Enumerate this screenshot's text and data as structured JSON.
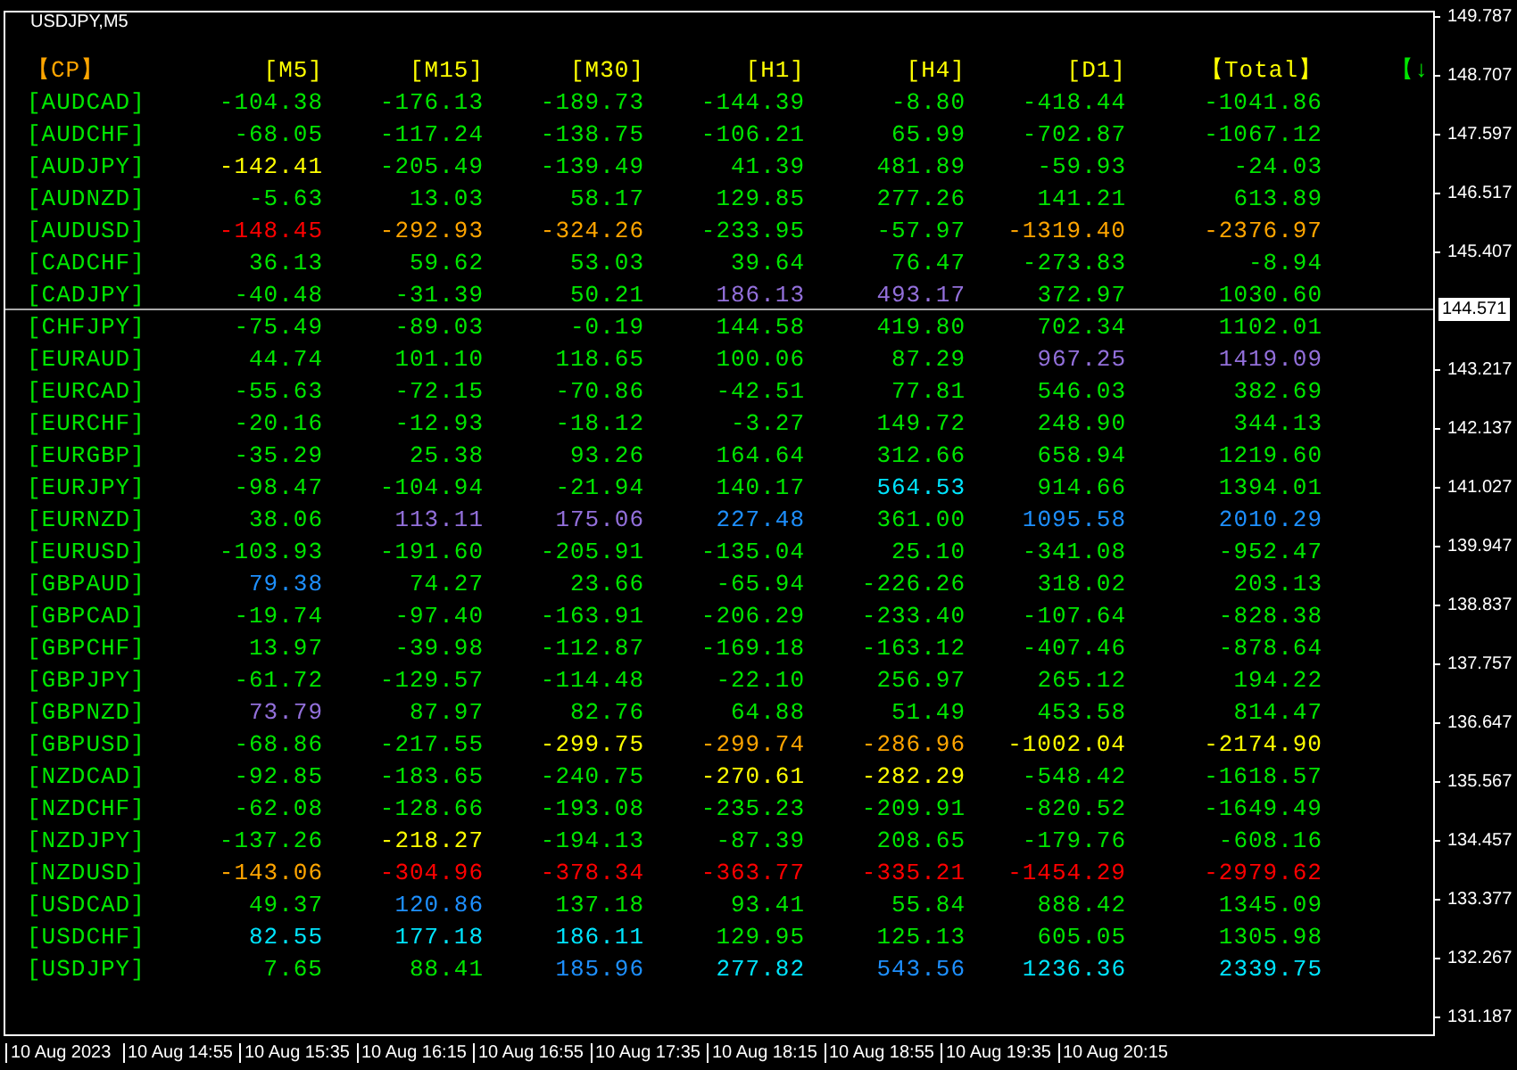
{
  "chart_title": "USDJPY,M5",
  "headers": [
    {
      "text": "【CP】",
      "color": "#ffa500"
    },
    {
      "text": "[M5]",
      "color": "#ffff00"
    },
    {
      "text": "[M15]",
      "color": "#ffff00"
    },
    {
      "text": "[M30]",
      "color": "#ffff00"
    },
    {
      "text": "[H1]",
      "color": "#ffff00"
    },
    {
      "text": "[H4]",
      "color": "#ffff00"
    },
    {
      "text": "[D1]",
      "color": "#ffff00"
    },
    {
      "text": "【Total】",
      "color": "#ffff00"
    },
    {
      "text": "【↓",
      "color": "#00e600"
    }
  ],
  "rows": [
    {
      "pair": "[AUDCAD]",
      "cells": [
        {
          "text": "-104.38",
          "color": "#00e600"
        },
        {
          "text": "-176.13",
          "color": "#00e600"
        },
        {
          "text": "-189.73",
          "color": "#00e600"
        },
        {
          "text": "-144.39",
          "color": "#00e600"
        },
        {
          "text": "-8.80",
          "color": "#00e600"
        },
        {
          "text": "-418.44",
          "color": "#00e600"
        },
        {
          "text": "-1041.86",
          "color": "#00e600"
        }
      ]
    },
    {
      "pair": "[AUDCHF]",
      "cells": [
        {
          "text": "-68.05",
          "color": "#00e600"
        },
        {
          "text": "-117.24",
          "color": "#00e600"
        },
        {
          "text": "-138.75",
          "color": "#00e600"
        },
        {
          "text": "-106.21",
          "color": "#00e600"
        },
        {
          "text": "65.99",
          "color": "#00e600"
        },
        {
          "text": "-702.87",
          "color": "#00e600"
        },
        {
          "text": "-1067.12",
          "color": "#00e600"
        }
      ]
    },
    {
      "pair": "[AUDJPY]",
      "cells": [
        {
          "text": "-142.41",
          "color": "#ffff00"
        },
        {
          "text": "-205.49",
          "color": "#00e600"
        },
        {
          "text": "-139.49",
          "color": "#00e600"
        },
        {
          "text": "41.39",
          "color": "#00e600"
        },
        {
          "text": "481.89",
          "color": "#00e600"
        },
        {
          "text": "-59.93",
          "color": "#00e600"
        },
        {
          "text": "-24.03",
          "color": "#00e600"
        }
      ]
    },
    {
      "pair": "[AUDNZD]",
      "cells": [
        {
          "text": "-5.63",
          "color": "#00e600"
        },
        {
          "text": "13.03",
          "color": "#00e600"
        },
        {
          "text": "58.17",
          "color": "#00e600"
        },
        {
          "text": "129.85",
          "color": "#00e600"
        },
        {
          "text": "277.26",
          "color": "#00e600"
        },
        {
          "text": "141.21",
          "color": "#00e600"
        },
        {
          "text": "613.89",
          "color": "#00e600"
        }
      ]
    },
    {
      "pair": "[AUDUSD]",
      "cells": [
        {
          "text": "-148.45",
          "color": "#ff0000"
        },
        {
          "text": "-292.93",
          "color": "#ffa500"
        },
        {
          "text": "-324.26",
          "color": "#ffa500"
        },
        {
          "text": "-233.95",
          "color": "#00e600"
        },
        {
          "text": "-57.97",
          "color": "#00e600"
        },
        {
          "text": "-1319.40",
          "color": "#ffa500"
        },
        {
          "text": "-2376.97",
          "color": "#ffa500"
        }
      ]
    },
    {
      "pair": "[CADCHF]",
      "cells": [
        {
          "text": "36.13",
          "color": "#00e600"
        },
        {
          "text": "59.62",
          "color": "#00e600"
        },
        {
          "text": "53.03",
          "color": "#00e600"
        },
        {
          "text": "39.64",
          "color": "#00e600"
        },
        {
          "text": "76.47",
          "color": "#00e600"
        },
        {
          "text": "-273.83",
          "color": "#00e600"
        },
        {
          "text": "-8.94",
          "color": "#00e600"
        }
      ]
    },
    {
      "pair": "[CADJPY]",
      "cells": [
        {
          "text": "-40.48",
          "color": "#00e600"
        },
        {
          "text": "-31.39",
          "color": "#00e600"
        },
        {
          "text": "50.21",
          "color": "#00e600"
        },
        {
          "text": "186.13",
          "color": "#9370db"
        },
        {
          "text": "493.17",
          "color": "#9370db"
        },
        {
          "text": "372.97",
          "color": "#00e600"
        },
        {
          "text": "1030.60",
          "color": "#00e600"
        }
      ]
    },
    {
      "pair": "[CHFJPY]",
      "cells": [
        {
          "text": "-75.49",
          "color": "#00e600"
        },
        {
          "text": "-89.03",
          "color": "#00e600"
        },
        {
          "text": "-0.19",
          "color": "#00e600"
        },
        {
          "text": "144.58",
          "color": "#00e600"
        },
        {
          "text": "419.80",
          "color": "#00e600"
        },
        {
          "text": "702.34",
          "color": "#00e600"
        },
        {
          "text": "1102.01",
          "color": "#00e600"
        }
      ]
    },
    {
      "pair": "[EURAUD]",
      "cells": [
        {
          "text": "44.74",
          "color": "#00e600"
        },
        {
          "text": "101.10",
          "color": "#00e600"
        },
        {
          "text": "118.65",
          "color": "#00e600"
        },
        {
          "text": "100.06",
          "color": "#00e600"
        },
        {
          "text": "87.29",
          "color": "#00e600"
        },
        {
          "text": "967.25",
          "color": "#9370db"
        },
        {
          "text": "1419.09",
          "color": "#9370db"
        }
      ]
    },
    {
      "pair": "[EURCAD]",
      "cells": [
        {
          "text": "-55.63",
          "color": "#00e600"
        },
        {
          "text": "-72.15",
          "color": "#00e600"
        },
        {
          "text": "-70.86",
          "color": "#00e600"
        },
        {
          "text": "-42.51",
          "color": "#00e600"
        },
        {
          "text": "77.81",
          "color": "#00e600"
        },
        {
          "text": "546.03",
          "color": "#00e600"
        },
        {
          "text": "382.69",
          "color": "#00e600"
        }
      ]
    },
    {
      "pair": "[EURCHF]",
      "cells": [
        {
          "text": "-20.16",
          "color": "#00e600"
        },
        {
          "text": "-12.93",
          "color": "#00e600"
        },
        {
          "text": "-18.12",
          "color": "#00e600"
        },
        {
          "text": "-3.27",
          "color": "#00e600"
        },
        {
          "text": "149.72",
          "color": "#00e600"
        },
        {
          "text": "248.90",
          "color": "#00e600"
        },
        {
          "text": "344.13",
          "color": "#00e600"
        }
      ]
    },
    {
      "pair": "[EURGBP]",
      "cells": [
        {
          "text": "-35.29",
          "color": "#00e600"
        },
        {
          "text": "25.38",
          "color": "#00e600"
        },
        {
          "text": "93.26",
          "color": "#00e600"
        },
        {
          "text": "164.64",
          "color": "#00e600"
        },
        {
          "text": "312.66",
          "color": "#00e600"
        },
        {
          "text": "658.94",
          "color": "#00e600"
        },
        {
          "text": "1219.60",
          "color": "#00e600"
        }
      ]
    },
    {
      "pair": "[EURJPY]",
      "cells": [
        {
          "text": "-98.47",
          "color": "#00e600"
        },
        {
          "text": "-104.94",
          "color": "#00e600"
        },
        {
          "text": "-21.94",
          "color": "#00e600"
        },
        {
          "text": "140.17",
          "color": "#00e600"
        },
        {
          "text": "564.53",
          "color": "#00e5ff"
        },
        {
          "text": "914.66",
          "color": "#00e600"
        },
        {
          "text": "1394.01",
          "color": "#00e600"
        }
      ]
    },
    {
      "pair": "[EURNZD]",
      "cells": [
        {
          "text": "38.06",
          "color": "#00e600"
        },
        {
          "text": "113.11",
          "color": "#9370db"
        },
        {
          "text": "175.06",
          "color": "#9370db"
        },
        {
          "text": "227.48",
          "color": "#1e90ff"
        },
        {
          "text": "361.00",
          "color": "#00e600"
        },
        {
          "text": "1095.58",
          "color": "#1e90ff"
        },
        {
          "text": "2010.29",
          "color": "#1e90ff"
        }
      ]
    },
    {
      "pair": "[EURUSD]",
      "cells": [
        {
          "text": "-103.93",
          "color": "#00e600"
        },
        {
          "text": "-191.60",
          "color": "#00e600"
        },
        {
          "text": "-205.91",
          "color": "#00e600"
        },
        {
          "text": "-135.04",
          "color": "#00e600"
        },
        {
          "text": "25.10",
          "color": "#00e600"
        },
        {
          "text": "-341.08",
          "color": "#00e600"
        },
        {
          "text": "-952.47",
          "color": "#00e600"
        }
      ]
    },
    {
      "pair": "[GBPAUD]",
      "cells": [
        {
          "text": "79.38",
          "color": "#1e90ff"
        },
        {
          "text": "74.27",
          "color": "#00e600"
        },
        {
          "text": "23.66",
          "color": "#00e600"
        },
        {
          "text": "-65.94",
          "color": "#00e600"
        },
        {
          "text": "-226.26",
          "color": "#00e600"
        },
        {
          "text": "318.02",
          "color": "#00e600"
        },
        {
          "text": "203.13",
          "color": "#00e600"
        }
      ]
    },
    {
      "pair": "[GBPCAD]",
      "cells": [
        {
          "text": "-19.74",
          "color": "#00e600"
        },
        {
          "text": "-97.40",
          "color": "#00e600"
        },
        {
          "text": "-163.91",
          "color": "#00e600"
        },
        {
          "text": "-206.29",
          "color": "#00e600"
        },
        {
          "text": "-233.40",
          "color": "#00e600"
        },
        {
          "text": "-107.64",
          "color": "#00e600"
        },
        {
          "text": "-828.38",
          "color": "#00e600"
        }
      ]
    },
    {
      "pair": "[GBPCHF]",
      "cells": [
        {
          "text": "13.97",
          "color": "#00e600"
        },
        {
          "text": "-39.98",
          "color": "#00e600"
        },
        {
          "text": "-112.87",
          "color": "#00e600"
        },
        {
          "text": "-169.18",
          "color": "#00e600"
        },
        {
          "text": "-163.12",
          "color": "#00e600"
        },
        {
          "text": "-407.46",
          "color": "#00e600"
        },
        {
          "text": "-878.64",
          "color": "#00e600"
        }
      ]
    },
    {
      "pair": "[GBPJPY]",
      "cells": [
        {
          "text": "-61.72",
          "color": "#00e600"
        },
        {
          "text": "-129.57",
          "color": "#00e600"
        },
        {
          "text": "-114.48",
          "color": "#00e600"
        },
        {
          "text": "-22.10",
          "color": "#00e600"
        },
        {
          "text": "256.97",
          "color": "#00e600"
        },
        {
          "text": "265.12",
          "color": "#00e600"
        },
        {
          "text": "194.22",
          "color": "#00e600"
        }
      ]
    },
    {
      "pair": "[GBPNZD]",
      "cells": [
        {
          "text": "73.79",
          "color": "#9370db"
        },
        {
          "text": "87.97",
          "color": "#00e600"
        },
        {
          "text": "82.76",
          "color": "#00e600"
        },
        {
          "text": "64.88",
          "color": "#00e600"
        },
        {
          "text": "51.49",
          "color": "#00e600"
        },
        {
          "text": "453.58",
          "color": "#00e600"
        },
        {
          "text": "814.47",
          "color": "#00e600"
        }
      ]
    },
    {
      "pair": "[GBPUSD]",
      "cells": [
        {
          "text": "-68.86",
          "color": "#00e600"
        },
        {
          "text": "-217.55",
          "color": "#00e600"
        },
        {
          "text": "-299.75",
          "color": "#ffff00"
        },
        {
          "text": "-299.74",
          "color": "#ffa500"
        },
        {
          "text": "-286.96",
          "color": "#ffa500"
        },
        {
          "text": "-1002.04",
          "color": "#ffff00"
        },
        {
          "text": "-2174.90",
          "color": "#ffff00"
        }
      ]
    },
    {
      "pair": "[NZDCAD]",
      "cells": [
        {
          "text": "-92.85",
          "color": "#00e600"
        },
        {
          "text": "-183.65",
          "color": "#00e600"
        },
        {
          "text": "-240.75",
          "color": "#00e600"
        },
        {
          "text": "-270.61",
          "color": "#ffff00"
        },
        {
          "text": "-282.29",
          "color": "#ffff00"
        },
        {
          "text": "-548.42",
          "color": "#00e600"
        },
        {
          "text": "-1618.57",
          "color": "#00e600"
        }
      ]
    },
    {
      "pair": "[NZDCHF]",
      "cells": [
        {
          "text": "-62.08",
          "color": "#00e600"
        },
        {
          "text": "-128.66",
          "color": "#00e600"
        },
        {
          "text": "-193.08",
          "color": "#00e600"
        },
        {
          "text": "-235.23",
          "color": "#00e600"
        },
        {
          "text": "-209.91",
          "color": "#00e600"
        },
        {
          "text": "-820.52",
          "color": "#00e600"
        },
        {
          "text": "-1649.49",
          "color": "#00e600"
        }
      ]
    },
    {
      "pair": "[NZDJPY]",
      "cells": [
        {
          "text": "-137.26",
          "color": "#00e600"
        },
        {
          "text": "-218.27",
          "color": "#ffff00"
        },
        {
          "text": "-194.13",
          "color": "#00e600"
        },
        {
          "text": "-87.39",
          "color": "#00e600"
        },
        {
          "text": "208.65",
          "color": "#00e600"
        },
        {
          "text": "-179.76",
          "color": "#00e600"
        },
        {
          "text": "-608.16",
          "color": "#00e600"
        }
      ]
    },
    {
      "pair": "[NZDUSD]",
      "cells": [
        {
          "text": "-143.06",
          "color": "#ffa500"
        },
        {
          "text": "-304.96",
          "color": "#ff0000"
        },
        {
          "text": "-378.34",
          "color": "#ff0000"
        },
        {
          "text": "-363.77",
          "color": "#ff0000"
        },
        {
          "text": "-335.21",
          "color": "#ff0000"
        },
        {
          "text": "-1454.29",
          "color": "#ff0000"
        },
        {
          "text": "-2979.62",
          "color": "#ff0000"
        }
      ]
    },
    {
      "pair": "[USDCAD]",
      "cells": [
        {
          "text": "49.37",
          "color": "#00e600"
        },
        {
          "text": "120.86",
          "color": "#1e90ff"
        },
        {
          "text": "137.18",
          "color": "#00e600"
        },
        {
          "text": "93.41",
          "color": "#00e600"
        },
        {
          "text": "55.84",
          "color": "#00e600"
        },
        {
          "text": "888.42",
          "color": "#00e600"
        },
        {
          "text": "1345.09",
          "color": "#00e600"
        }
      ]
    },
    {
      "pair": "[USDCHF]",
      "cells": [
        {
          "text": "82.55",
          "color": "#00e5ff"
        },
        {
          "text": "177.18",
          "color": "#00e5ff"
        },
        {
          "text": "186.11",
          "color": "#00e5ff"
        },
        {
          "text": "129.95",
          "color": "#00e600"
        },
        {
          "text": "125.13",
          "color": "#00e600"
        },
        {
          "text": "605.05",
          "color": "#00e600"
        },
        {
          "text": "1305.98",
          "color": "#00e600"
        }
      ]
    },
    {
      "pair": "[USDJPY]",
      "cells": [
        {
          "text": "7.65",
          "color": "#00e600"
        },
        {
          "text": "88.41",
          "color": "#00e600"
        },
        {
          "text": "185.96",
          "color": "#1e90ff"
        },
        {
          "text": "277.82",
          "color": "#00e5ff"
        },
        {
          "text": "543.56",
          "color": "#1e90ff"
        },
        {
          "text": "1236.36",
          "color": "#00e5ff"
        },
        {
          "text": "2339.75",
          "color": "#00e5ff"
        }
      ]
    }
  ],
  "price_axis": [
    "149.787",
    "148.707",
    "147.597",
    "146.517",
    "145.407",
    "143.217",
    "142.137",
    "141.027",
    "139.947",
    "138.837",
    "137.757",
    "136.647",
    "135.567",
    "134.457",
    "133.377",
    "132.267",
    "131.187"
  ],
  "current_price": "144.571",
  "time_axis": [
    "10 Aug 2023",
    "10 Aug 14:55",
    "10 Aug 15:35",
    "10 Aug 16:15",
    "10 Aug 16:55",
    "10 Aug 17:35",
    "10 Aug 18:15",
    "10 Aug 18:55",
    "10 Aug 19:35",
    "10 Aug 20:15"
  ]
}
